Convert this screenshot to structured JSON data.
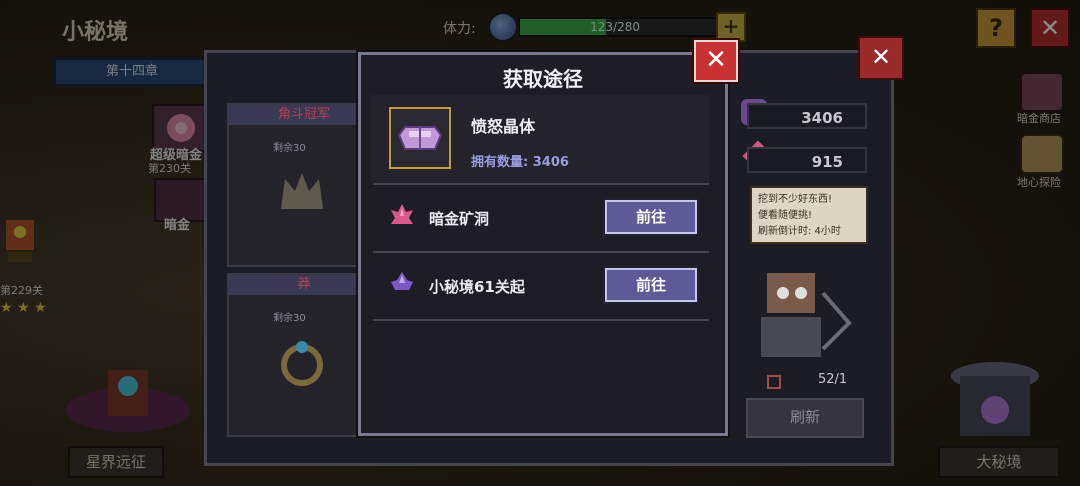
{
  "header": {
    "title": "小秘境",
    "stamina_label": "体力:",
    "stamina_text": "123/280",
    "stamina_fraction": 0.44,
    "plus": "+",
    "help": "?",
    "close": "✕"
  },
  "left": {
    "chapter": "第十四章",
    "super_dark_gold": "超级暗金",
    "stage_230": "第230关",
    "dark_gold": "暗金",
    "stage_229": "第229关",
    "bottom_button": "星界远征"
  },
  "right": {
    "dark_shop": "暗金商店",
    "core_explore": "地心探险",
    "bottom_button": "大秘境"
  },
  "panel": {
    "card1_title": "角斗冠军",
    "card2_title": "莽",
    "remain1": "剩余30",
    "remain2": "剩余30",
    "stat1": "3406",
    "stat2": "915",
    "speech_line1": "挖到不少好东西!",
    "speech_line2": "便看随便挑!",
    "speech_line3": "刷新倒计时: 4小时",
    "count": "52/1",
    "refresh": "刷新"
  },
  "popup": {
    "title": "获取途径",
    "close": "✕",
    "item_name": "愤怒晶体",
    "item_count_label": "拥有数量:",
    "item_count": "3406",
    "sources": [
      {
        "label": "暗金矿洞",
        "button": "前往",
        "icon": "pink-crystal-icon"
      },
      {
        "label": "小秘境61关起",
        "button": "前往",
        "icon": "purple-crystal-icon"
      }
    ]
  },
  "colors": {
    "accent_button": "#5e5a98",
    "close_red": "#c83232",
    "count_text": "#9a9ce0",
    "slot_border": "#c09a3c"
  }
}
